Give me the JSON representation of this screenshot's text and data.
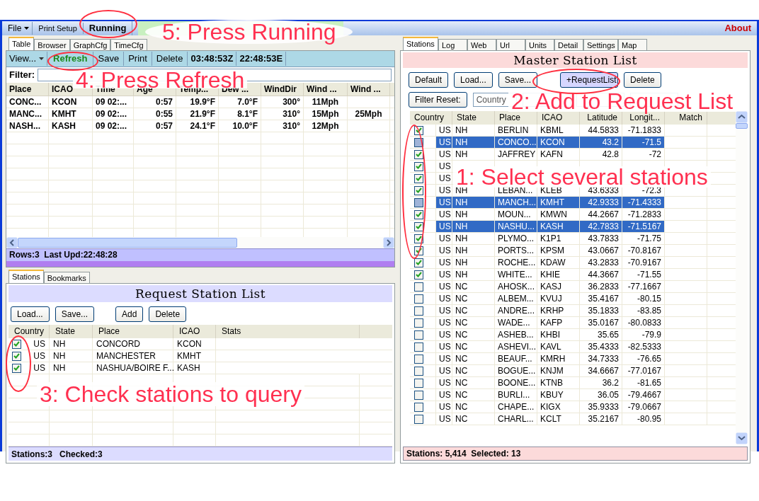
{
  "menu_bar": {
    "items": [
      {
        "label": "File",
        "kind": "dropdown"
      },
      {
        "label": "Print Setup",
        "kind": "plain"
      },
      {
        "label": "Running",
        "kind": "toggle"
      }
    ],
    "about": "About"
  },
  "data_panel": {
    "tabs": [
      {
        "label": "Table",
        "selected": true
      },
      {
        "label": "Browser",
        "selected": false
      },
      {
        "label": "GraphCfg",
        "selected": false
      },
      {
        "label": "TimeCfg",
        "selected": false
      }
    ],
    "toolbar": [
      {
        "label": "View...",
        "kind": "dropdown"
      },
      {
        "label": "Refresh",
        "kind": "highlight"
      },
      {
        "label": "Save",
        "kind": "plain"
      },
      {
        "label": "Print",
        "kind": "plain"
      },
      {
        "label": "Delete",
        "kind": "plain"
      },
      {
        "label": "03:48:53Z",
        "kind": "time"
      },
      {
        "label": "22:48:53E",
        "kind": "time"
      }
    ],
    "filter_label": "Filter:",
    "columns": [
      "Place",
      "ICAO",
      "Time",
      "Age",
      "Temp...",
      "Dew ...",
      "WindDir",
      "Wind ...",
      "Wind ..."
    ],
    "rows": [
      [
        "CONC...",
        "KCON",
        "09 02:...",
        "0:57",
        "19.9°F",
        "7.0°F",
        "300°",
        "11Mph",
        null
      ],
      [
        "MANC...",
        "KMHT",
        "09 02:...",
        "0:55",
        "21.9°F",
        "8.1°F",
        "310°",
        "15Mph",
        "25Mph"
      ],
      [
        "NASH...",
        "KASH",
        "09 02:...",
        "0:57",
        "24.1°F",
        "10.0°F",
        "310°",
        "12Mph",
        null
      ]
    ],
    "status": "Rows:3  Last Upd:22:48:28"
  },
  "request_panel": {
    "tabs": [
      {
        "label": "Stations",
        "selected": true
      },
      {
        "label": "Bookmarks",
        "selected": false
      }
    ],
    "title": "Request Station List",
    "buttons": [
      "Load...",
      "Save...",
      "Add",
      "Delete"
    ],
    "columns": [
      "Country",
      "State",
      "Place",
      "ICAO",
      "Stats"
    ],
    "rows": [
      {
        "checked": true,
        "cells": [
          "US",
          "NH",
          "CONCORD",
          "KCON"
        ]
      },
      {
        "checked": true,
        "cells": [
          "US",
          "NH",
          "MANCHESTER",
          "KMHT"
        ]
      },
      {
        "checked": true,
        "cells": [
          "US",
          "NH",
          "NASHUA/BOIRE F...",
          "KASH"
        ]
      }
    ],
    "status": "Stations:3   Checked:3"
  },
  "master_panel": {
    "tabs": [
      {
        "label": "Stations",
        "selected": true
      },
      {
        "label": "Log",
        "selected": false
      },
      {
        "label": "Web",
        "selected": false
      },
      {
        "label": "Url",
        "selected": false
      },
      {
        "label": "Units",
        "selected": false
      },
      {
        "label": "Detail",
        "selected": false
      },
      {
        "label": "Settings",
        "selected": false
      },
      {
        "label": "Map",
        "selected": false
      }
    ],
    "title": "Master Station List",
    "buttons": [
      {
        "label": "Default",
        "kind": "plain"
      },
      {
        "label": "Load...",
        "kind": "plain"
      },
      {
        "label": "Save...",
        "kind": "plain"
      },
      {
        "label": "+RequestList",
        "kind": "highlight"
      },
      {
        "label": "Delete",
        "kind": "plain"
      }
    ],
    "filter_button": "Filter Reset:",
    "filters": [
      {
        "placeholder": "Country"
      }
    ],
    "columns": [
      "Country",
      "State",
      "Place",
      "ICAO",
      "Latitude",
      "Longit...",
      "Match"
    ],
    "rows": [
      {
        "checked": true,
        "selected": false,
        "cells": [
          "US",
          "NH",
          "BERLIN",
          "KBML",
          "44.5833",
          "-71.1833"
        ]
      },
      {
        "checked": false,
        "selected": true,
        "cells": [
          "US",
          "NH",
          "CONCO...",
          "KCON",
          "43.2",
          "-71.5"
        ]
      },
      {
        "checked": true,
        "selected": false,
        "cells": [
          "US",
          "NH",
          "JAFFREY",
          "KAFN",
          "42.8",
          "-72"
        ]
      },
      {
        "checked": true,
        "selected": false,
        "cells": [
          "US"
        ]
      },
      {
        "checked": true,
        "selected": false,
        "cells": [
          "US"
        ]
      },
      {
        "checked": true,
        "selected": false,
        "cells": [
          "US",
          "NH",
          "LEBAN...",
          "KLEB",
          "43.6333",
          "-72.3"
        ]
      },
      {
        "checked": false,
        "selected": true,
        "cells": [
          "US",
          "NH",
          "MANCH...",
          "KMHT",
          "42.9333",
          "-71.4333"
        ]
      },
      {
        "checked": true,
        "selected": false,
        "cells": [
          "US",
          "NH",
          "MOUN...",
          "KMWN",
          "44.2667",
          "-71.2833"
        ]
      },
      {
        "checked": true,
        "selected": true,
        "cells": [
          "US",
          "NH",
          "NASHU...",
          "KASH",
          "42.7833",
          "-71.5167"
        ]
      },
      {
        "checked": true,
        "selected": false,
        "cells": [
          "US",
          "NH",
          "PLYMO...",
          "K1P1",
          "43.7833",
          "-71.75"
        ]
      },
      {
        "checked": true,
        "selected": false,
        "cells": [
          "US",
          "NH",
          "PORTS...",
          "KPSM",
          "43.0667",
          "-70.8167"
        ]
      },
      {
        "checked": true,
        "selected": false,
        "cells": [
          "US",
          "NH",
          "ROCHE...",
          "KDAW",
          "43.2833",
          "-70.9167"
        ]
      },
      {
        "checked": true,
        "selected": false,
        "cells": [
          "US",
          "NH",
          "WHITE...",
          "KHIE",
          "44.3667",
          "-71.55"
        ]
      },
      {
        "checked": false,
        "selected": false,
        "cells": [
          "US",
          "NC",
          "AHOSK...",
          "KASJ",
          "36.2833",
          "-77.1667"
        ]
      },
      {
        "checked": false,
        "selected": false,
        "cells": [
          "US",
          "NC",
          "ALBEM...",
          "KVUJ",
          "35.4167",
          "-80.15"
        ]
      },
      {
        "checked": false,
        "selected": false,
        "cells": [
          "US",
          "NC",
          "ANDRE...",
          "KRHP",
          "35.1833",
          "-83.85"
        ]
      },
      {
        "checked": false,
        "selected": false,
        "cells": [
          "US",
          "NC",
          "WADE...",
          "KAFP",
          "35.0167",
          "-80.0833"
        ]
      },
      {
        "checked": false,
        "selected": false,
        "cells": [
          "US",
          "NC",
          "ASHEB...",
          "KHBI",
          "35.65",
          "-79.9"
        ]
      },
      {
        "checked": false,
        "selected": false,
        "cells": [
          "US",
          "NC",
          "ASHEVI...",
          "KAVL",
          "35.4333",
          "-82.5333"
        ]
      },
      {
        "checked": false,
        "selected": false,
        "cells": [
          "US",
          "NC",
          "BEAUF...",
          "KMRH",
          "34.7333",
          "-76.65"
        ]
      },
      {
        "checked": false,
        "selected": false,
        "cells": [
          "US",
          "NC",
          "BOGUE...",
          "KNJM",
          "34.6667",
          "-77.0167"
        ]
      },
      {
        "checked": false,
        "selected": false,
        "cells": [
          "US",
          "NC",
          "BOONE...",
          "KTNB",
          "36.2",
          "-81.65"
        ]
      },
      {
        "checked": false,
        "selected": false,
        "cells": [
          "US",
          "NC",
          "BURLI...",
          "KBUY",
          "36.05",
          "-79.4667"
        ]
      },
      {
        "checked": false,
        "selected": false,
        "cells": [
          "US",
          "NC",
          "CHAPE...",
          "KIGX",
          "35.9333",
          "-79.0667"
        ]
      },
      {
        "checked": false,
        "selected": false,
        "cells": [
          "US",
          "NC",
          "CHARL...",
          "KCLT",
          "35.2167",
          "-80.95"
        ]
      }
    ],
    "status": "Stations: 5,414  Selected: 13"
  },
  "annotations": [
    "5: Press Running",
    "4: Press Refresh",
    "2: Add to Request List",
    "1: Select several stations",
    "3: Check stations to query"
  ]
}
